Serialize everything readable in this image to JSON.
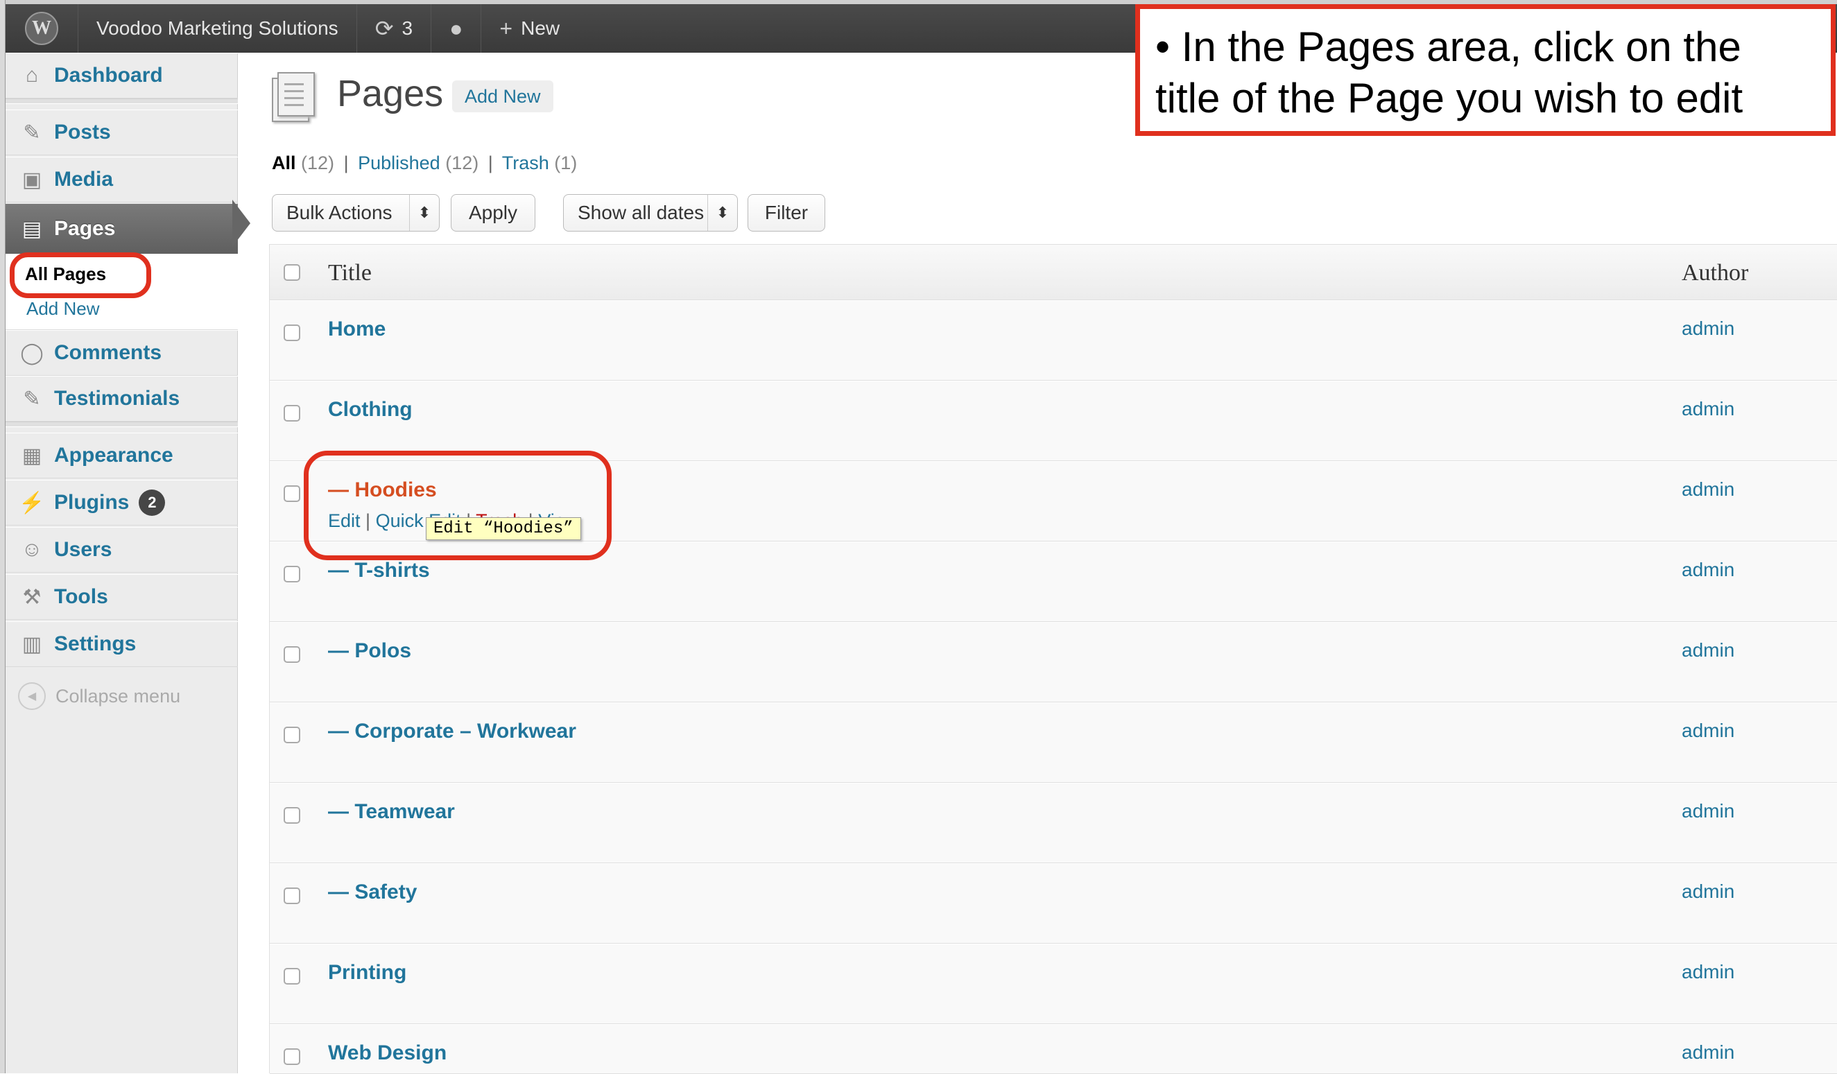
{
  "admin_bar": {
    "site_name": "Voodoo Marketing Solutions",
    "updates_count": "3",
    "new_label": "New"
  },
  "menu": {
    "items": [
      {
        "label": "Dashboard",
        "icon": "home-icon"
      },
      {
        "label": "Posts",
        "icon": "pushpin-icon"
      },
      {
        "label": "Media",
        "icon": "media-icon"
      },
      {
        "label": "Pages",
        "icon": "pages-icon"
      },
      {
        "label": "Comments",
        "icon": "comment-icon"
      },
      {
        "label": "Testimonials",
        "icon": "pushpin-icon"
      },
      {
        "label": "Appearance",
        "icon": "appearance-icon"
      },
      {
        "label": "Plugins",
        "icon": "plug-icon"
      },
      {
        "label": "Users",
        "icon": "users-icon"
      },
      {
        "label": "Tools",
        "icon": "tools-icon"
      },
      {
        "label": "Settings",
        "icon": "settings-icon"
      }
    ],
    "pages_submenu": {
      "all_pages": "All Pages",
      "add_new": "Add New"
    },
    "plugins_badge": "2",
    "collapse_label": "Collapse menu"
  },
  "content": {
    "title": "Pages",
    "add_new": "Add New",
    "filters": {
      "all": "All",
      "all_count": "(12)",
      "published": "Published",
      "published_count": "(12)",
      "trash": "Trash",
      "trash_count": "(1)",
      "separator": "|"
    },
    "bulk_actions": "Bulk Actions",
    "apply": "Apply",
    "dates": "Show all dates",
    "filter": "Filter",
    "columns": {
      "title": "Title",
      "author": "Author"
    },
    "rows": [
      {
        "title": "Home",
        "author": "admin"
      },
      {
        "title": "Clothing",
        "author": "admin"
      },
      {
        "title": "— Hoodies",
        "author": "admin"
      },
      {
        "title": "— T-shirts",
        "author": "admin"
      },
      {
        "title": "— Polos",
        "author": "admin"
      },
      {
        "title": "— Corporate – Workwear",
        "author": "admin"
      },
      {
        "title": "— Teamwear",
        "author": "admin"
      },
      {
        "title": "— Safety",
        "author": "admin"
      },
      {
        "title": "Printing",
        "author": "admin"
      },
      {
        "title": "Web Design",
        "author": "admin"
      }
    ],
    "row_actions": {
      "edit": "Edit",
      "quick_edit": "Quick Edit",
      "trash": "Trash",
      "view": "View"
    },
    "tooltip": "Edit “Hoodies”"
  },
  "annotation": {
    "text": "• In the Pages area, click on the title of the Page you wish to edit",
    "color": "#e0301e"
  }
}
